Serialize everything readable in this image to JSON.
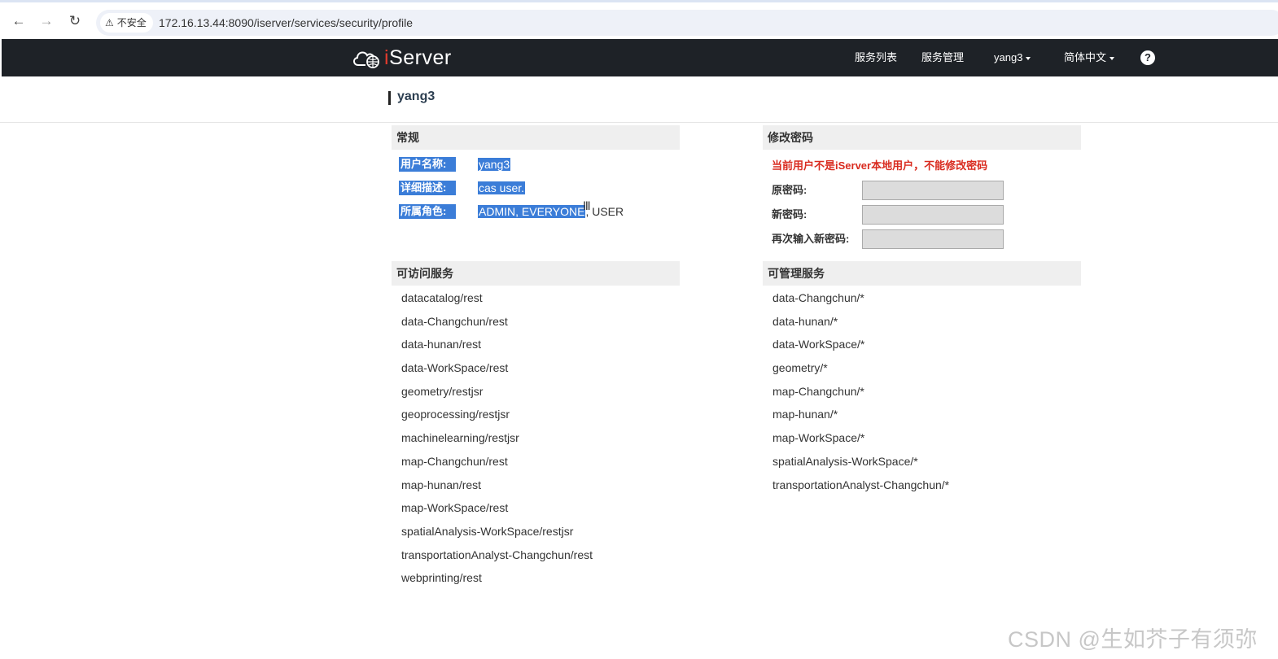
{
  "browser": {
    "security_label": "不安全",
    "url": "172.16.13.44:8090/iserver/services/security/profile"
  },
  "header": {
    "logo_text": "Server",
    "logo_i": "i",
    "nav": [
      "服务列表",
      "服务管理",
      "yang3",
      "简体中文"
    ],
    "help": "?"
  },
  "page": {
    "title": "yang3"
  },
  "general": {
    "heading": "常规",
    "fields": [
      {
        "label": "用户名称:",
        "value": "yang3"
      },
      {
        "label": "详细描述:",
        "value": "cas user."
      },
      {
        "label": "所属角色:",
        "value_selected": "ADMIN, EVERYONE",
        "value_rest": ", USER"
      }
    ]
  },
  "password": {
    "heading": "修改密码",
    "warning": "当前用户不是iServer本地用户，不能修改密码",
    "fields": [
      "原密码:",
      "新密码:",
      "再次输入新密码:"
    ]
  },
  "accessible": {
    "heading": "可访问服务",
    "items": [
      "datacatalog/rest",
      "data-Changchun/rest",
      "data-hunan/rest",
      "data-WorkSpace/rest",
      "geometry/restjsr",
      "geoprocessing/restjsr",
      "machinelearning/restjsr",
      "map-Changchun/rest",
      "map-hunan/rest",
      "map-WorkSpace/rest",
      "spatialAnalysis-WorkSpace/restjsr",
      "transportationAnalyst-Changchun/rest",
      "webprinting/rest"
    ]
  },
  "manageable": {
    "heading": "可管理服务",
    "items": [
      "data-Changchun/*",
      "data-hunan/*",
      "data-WorkSpace/*",
      "geometry/*",
      "map-Changchun/*",
      "map-hunan/*",
      "map-WorkSpace/*",
      "spatialAnalysis-WorkSpace/*",
      "transportationAnalyst-Changchun/*"
    ]
  },
  "watermark": "CSDN @生如芥子有须弥"
}
